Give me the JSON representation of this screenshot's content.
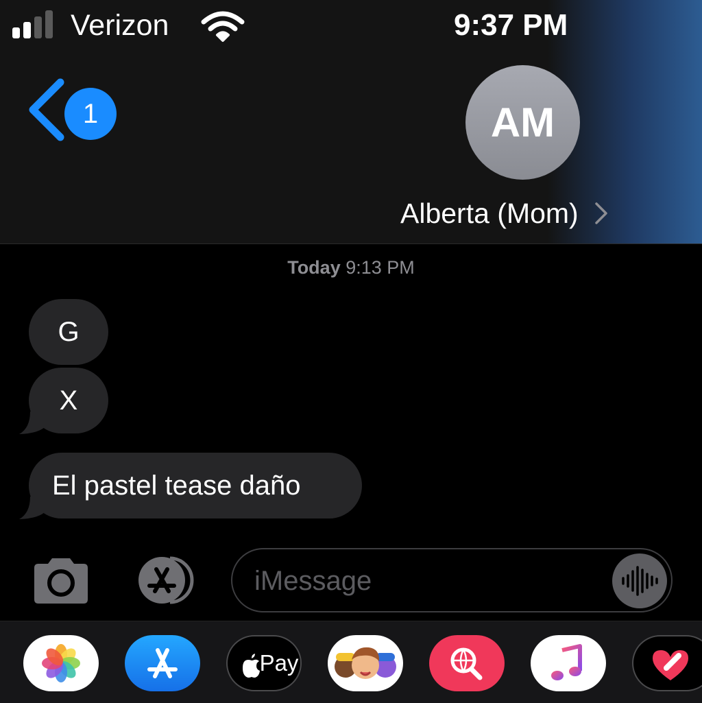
{
  "status_bar": {
    "carrier": "Verizon",
    "time": "9:37 PM",
    "signal_bars_filled": 2,
    "signal_bars_total": 4
  },
  "header": {
    "back_badge_count": "1",
    "contact_initials": "AM",
    "contact_name": "Alberta (Mom)"
  },
  "conversation": {
    "timestamp_day": "Today",
    "timestamp_time": "9:13 PM",
    "messages": [
      {
        "text": "G",
        "direction": "incoming"
      },
      {
        "text": "X",
        "direction": "incoming"
      },
      {
        "text": "El pastel tease daño",
        "direction": "incoming"
      }
    ]
  },
  "composer": {
    "placeholder": "iMessage"
  },
  "app_drawer": {
    "apps": [
      {
        "name": "photos-app-icon"
      },
      {
        "name": "app-store-app-icon"
      },
      {
        "name": "apple-pay-app-icon",
        "label": "Pay"
      },
      {
        "name": "memoji-app-icon"
      },
      {
        "name": "images-search-app-icon"
      },
      {
        "name": "music-app-icon"
      },
      {
        "name": "digital-touch-app-icon"
      }
    ]
  },
  "colors": {
    "accent_blue": "#1a8cff",
    "incoming_bubble": "#262628",
    "header_bg": "#141414",
    "secondary_text": "#8e8e93"
  }
}
